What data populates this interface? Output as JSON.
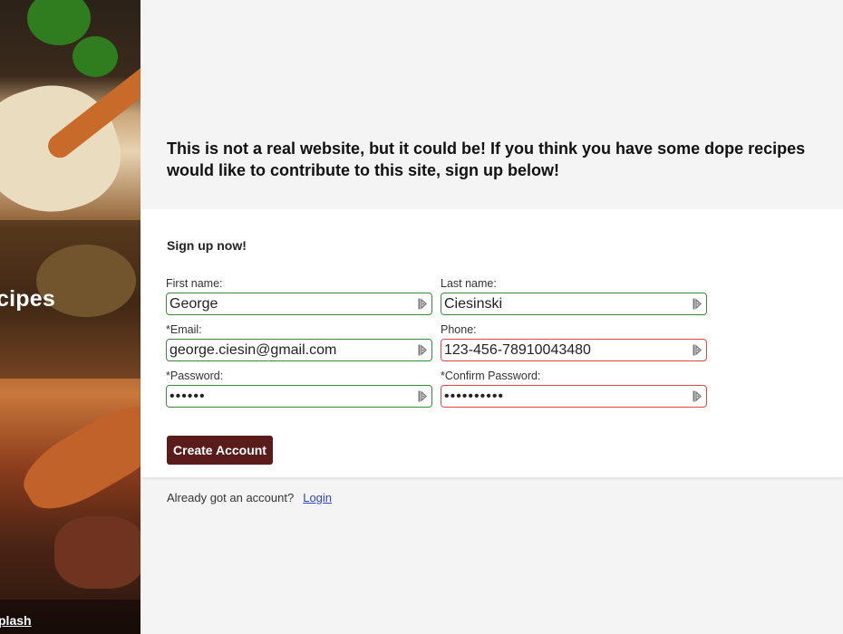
{
  "sidebar": {
    "banner_title": "cipes",
    "photo_credit": "plash"
  },
  "intro": {
    "line1": "This is not a real website, but it could be! If you think you have some dope recipes",
    "line2": "would like to contribute to this site, sign up below!"
  },
  "form": {
    "title": "Sign up now!",
    "fields": {
      "first_name": {
        "label": "First name:",
        "value": "George",
        "valid": true
      },
      "last_name": {
        "label": "Last name:",
        "value": "Ciesinski",
        "valid": true
      },
      "email": {
        "label": "*Email:",
        "value": "george.ciesin@gmail.com",
        "valid": true
      },
      "phone": {
        "label": "Phone:",
        "value": "123-456-78910043480",
        "valid": false
      },
      "password": {
        "label": "*Password:",
        "value": "••••••",
        "valid": true
      },
      "confirm_password": {
        "label": "*Confirm Password:",
        "value": "••••••••••",
        "valid": false
      }
    },
    "field_icon": "password-manager-key-icon",
    "submit_label": "Create Account"
  },
  "footer": {
    "prompt": "Already got an account?",
    "login_label": "Login"
  },
  "colors": {
    "valid_border": "#3b8a3b",
    "invalid_border": "#e04848",
    "button_bg": "#5a1b1b",
    "link": "#3344cc",
    "page_bg": "#f4f4f4"
  }
}
